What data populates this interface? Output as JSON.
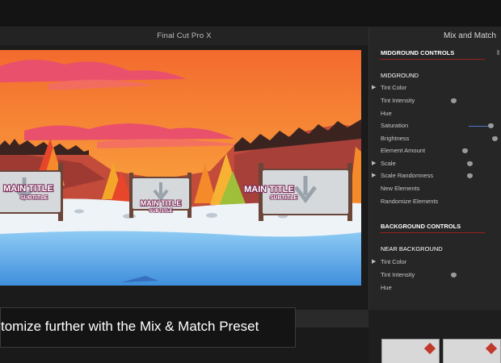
{
  "app": {
    "title": "Final Cut Pro X"
  },
  "inspector": {
    "header": "Mix and Match",
    "sections": {
      "midground_controls": "MIDGROUND CONTROLS",
      "midground": "MIDGROUND",
      "background_controls": "BACKGROUND CONTROLS",
      "near_background": "NEAR BACKGROUND"
    },
    "midground_params": [
      "Tint Color",
      "Tint Intensity",
      "Hue",
      "Saturation",
      "Brightness",
      "Element Amount",
      "Scale",
      "Scale Randomness",
      "New Elements",
      "Randomize Elements"
    ],
    "background_params": [
      "Tint Color",
      "Tint Intensity",
      "Hue"
    ]
  },
  "viewer": {
    "signs": [
      {
        "title": "MAIN TITLE",
        "subtitle": "SUBTITLE"
      },
      {
        "title": "MAIN TITLE",
        "subtitle": "SUBTITLE"
      },
      {
        "title": "MAIN TITLE",
        "subtitle": "SUBTITLE"
      }
    ],
    "colors": {
      "sky": "#f57d34",
      "cloud": "#e8456f",
      "snow": "#eef3f7",
      "ice": "#5ea8e6"
    }
  },
  "caption": {
    "text": "tomize further with the Mix & Match Preset"
  }
}
